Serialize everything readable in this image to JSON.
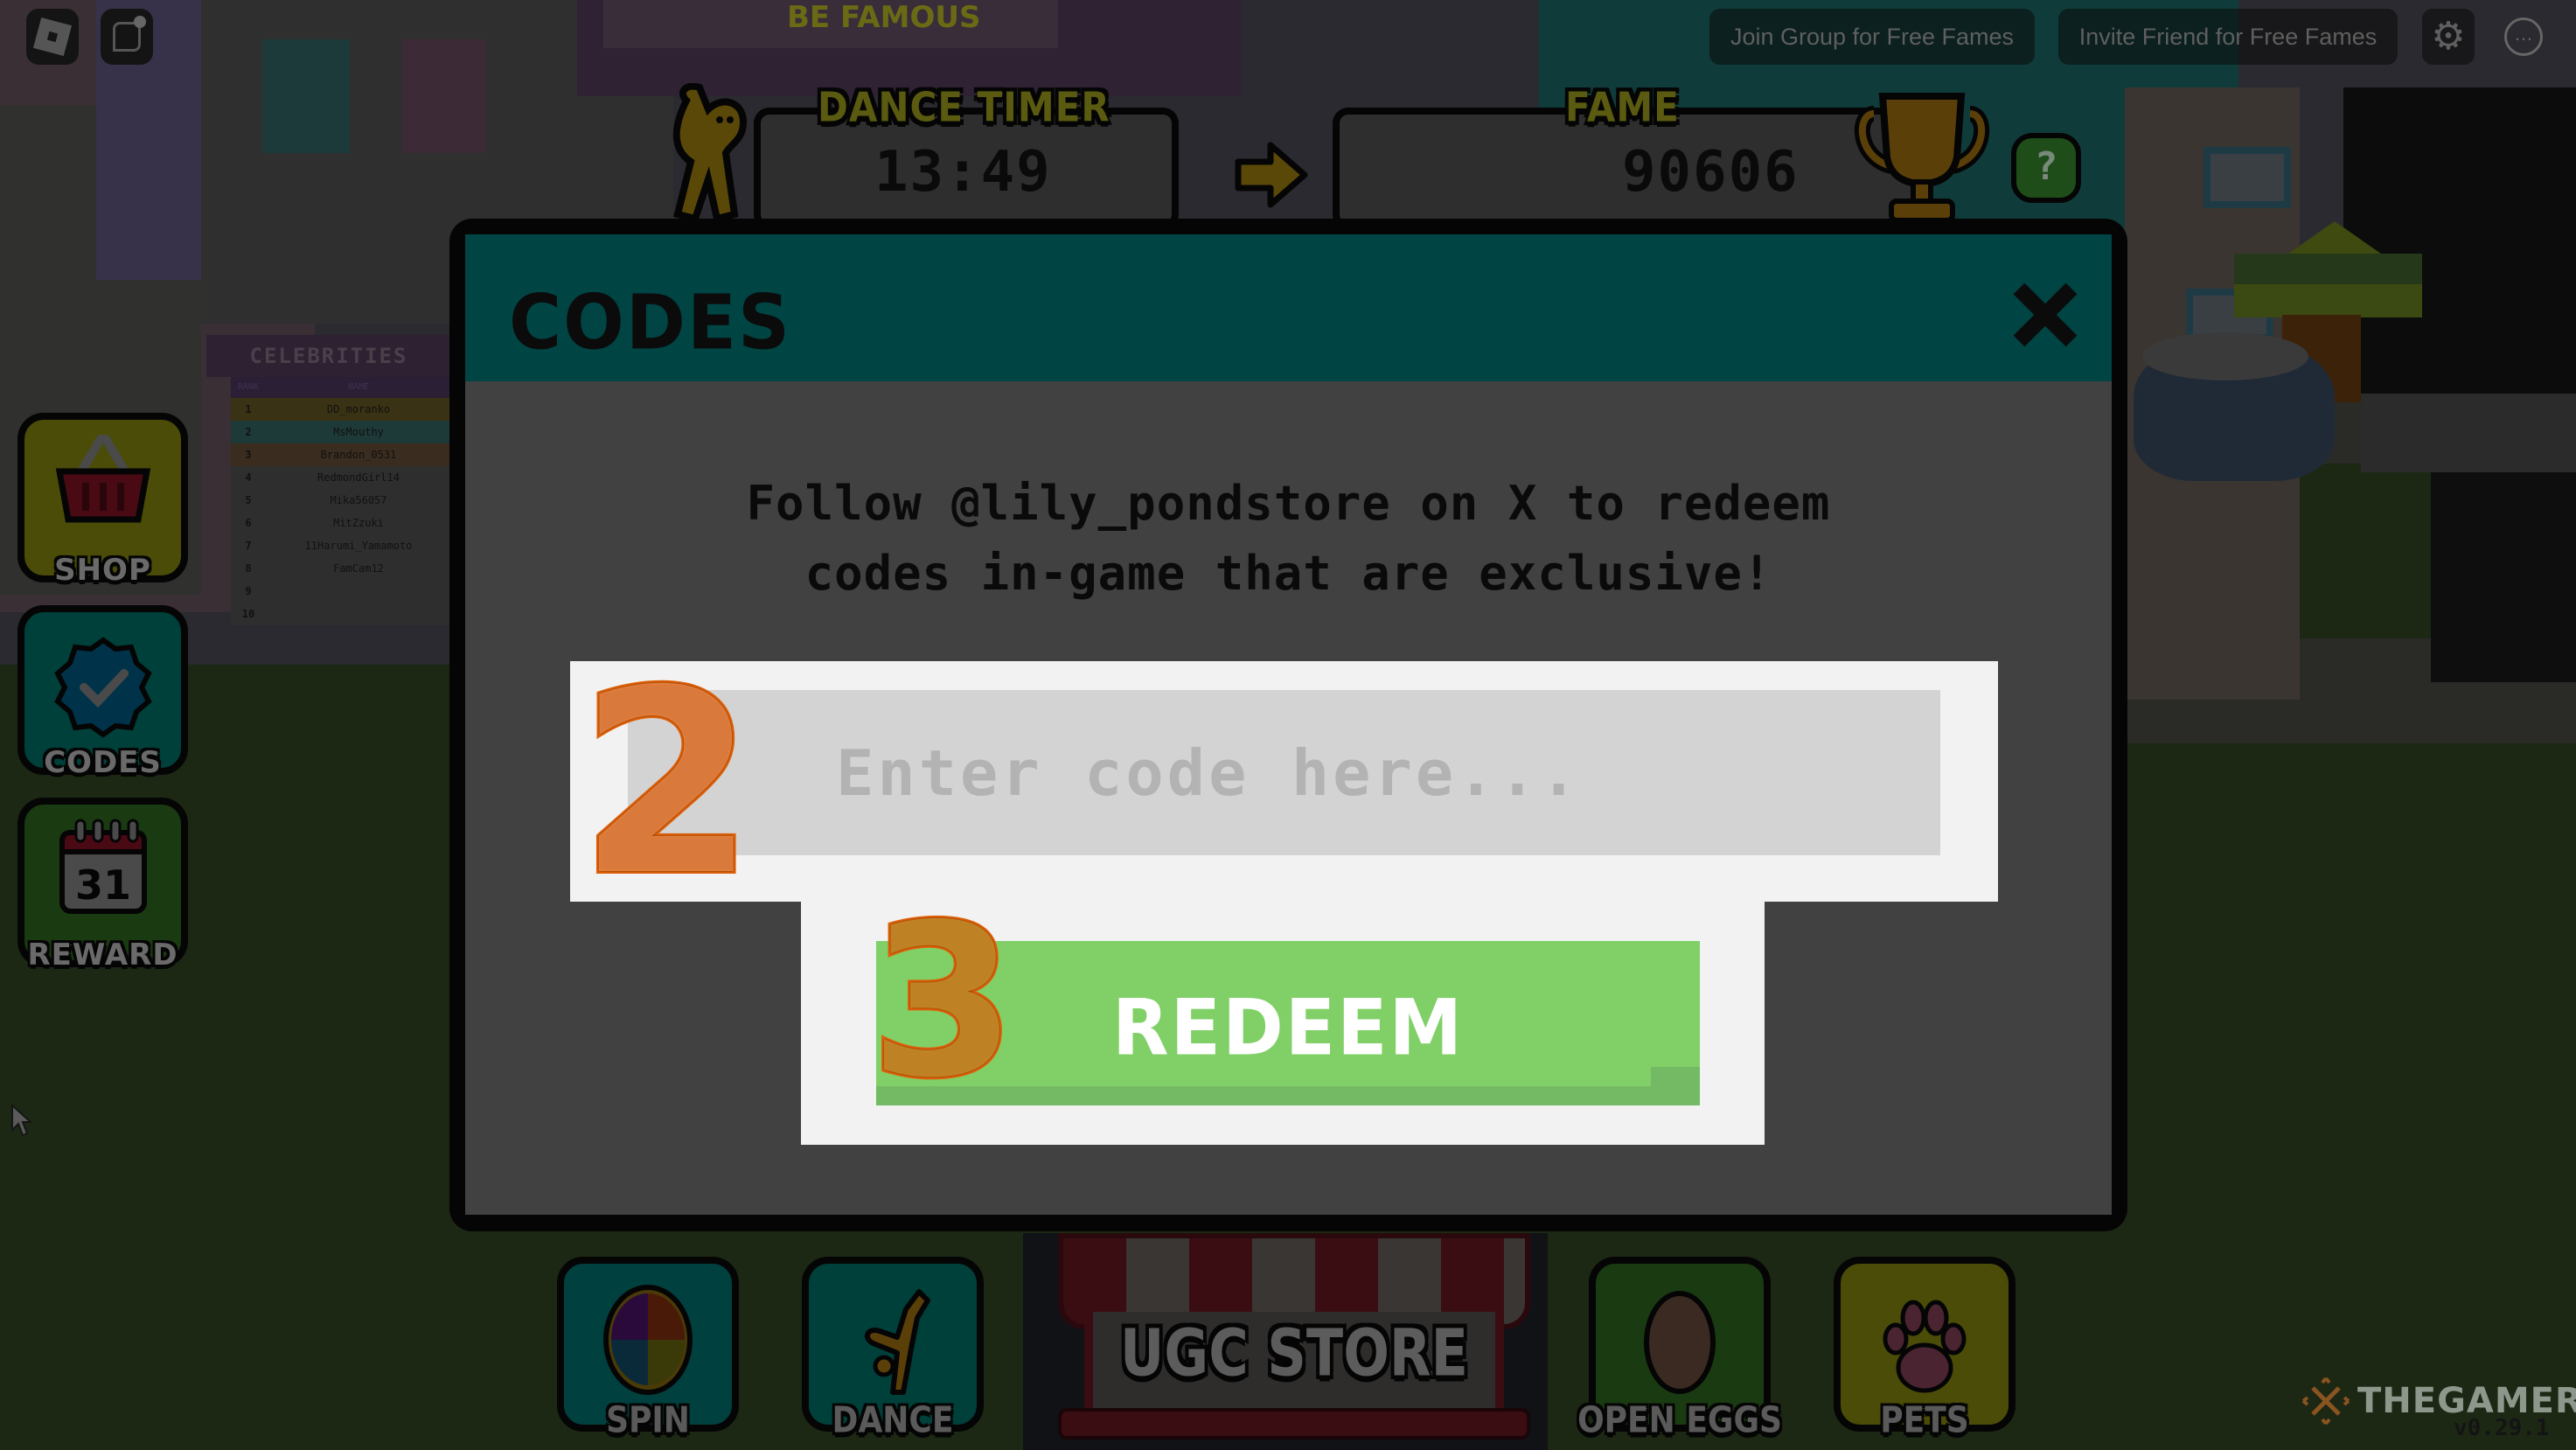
{
  "top_bar": {
    "join_group_label": "Join Group for Free Fames",
    "invite_friend_label": "Invite Friend for Free Fames",
    "settings_icon": "gear-icon",
    "more_icon": "more-icon",
    "more_glyph": "…"
  },
  "hud": {
    "dance_timer_label": "DANCE TIMER",
    "dance_timer_value": "13:49",
    "fame_label": "FAME",
    "fame_value": "90606",
    "help_glyph": "?"
  },
  "background_sign": "BE FAMOUS",
  "leaderboard": {
    "title": "CELEBRITIES",
    "columns": [
      "RANK",
      "NAME"
    ],
    "rows": [
      {
        "rank": "1",
        "name": "DD_moranko"
      },
      {
        "rank": "2",
        "name": "MsMouthy"
      },
      {
        "rank": "3",
        "name": "Brandon_0531"
      },
      {
        "rank": "4",
        "name": "RedmondGirl14"
      },
      {
        "rank": "5",
        "name": "Mika56057"
      },
      {
        "rank": "6",
        "name": "MitZzuki"
      },
      {
        "rank": "7",
        "name": "11Harumi_Yamamoto"
      },
      {
        "rank": "8",
        "name": "FamCam12"
      },
      {
        "rank": "9",
        "name": ""
      },
      {
        "rank": "10",
        "name": ""
      }
    ]
  },
  "side_menu": [
    {
      "label": "SHOP",
      "icon": "basket-icon"
    },
    {
      "label": "CODES",
      "icon": "verified-badge-icon"
    },
    {
      "label": "REWARD",
      "icon": "calendar-icon",
      "calendar_day": "31"
    }
  ],
  "bottom_bar": [
    {
      "label": "SPIN",
      "icon": "color-wheel-icon"
    },
    {
      "label": "DANCE",
      "icon": "dancer-icon"
    },
    {
      "label": "UGC STORE",
      "icon": "storefront-icon"
    },
    {
      "label": "OPEN EGGS",
      "icon": "egg-icon"
    },
    {
      "label": "PETS",
      "icon": "paw-icon"
    }
  ],
  "modal": {
    "title": "CODES",
    "description_line1": "Follow @lily_pondstore on X to redeem",
    "description_line2": "codes in-game that are exclusive!",
    "input_value": "",
    "input_placeholder": "Enter code here...",
    "redeem_label": "REDEEM",
    "close_icon": "close-icon"
  },
  "annotations": {
    "step_input": "2",
    "step_redeem": "3"
  },
  "watermark": {
    "brand": "THEGAMER",
    "version": "v0.29.1"
  },
  "colors": {
    "modal_header": "#004443",
    "modal_body": "#414141",
    "panel": "#f2f2f2",
    "input_bg": "#d3d3d3",
    "redeem_green": "#80d067",
    "annotation_orange": "#e0620a"
  }
}
